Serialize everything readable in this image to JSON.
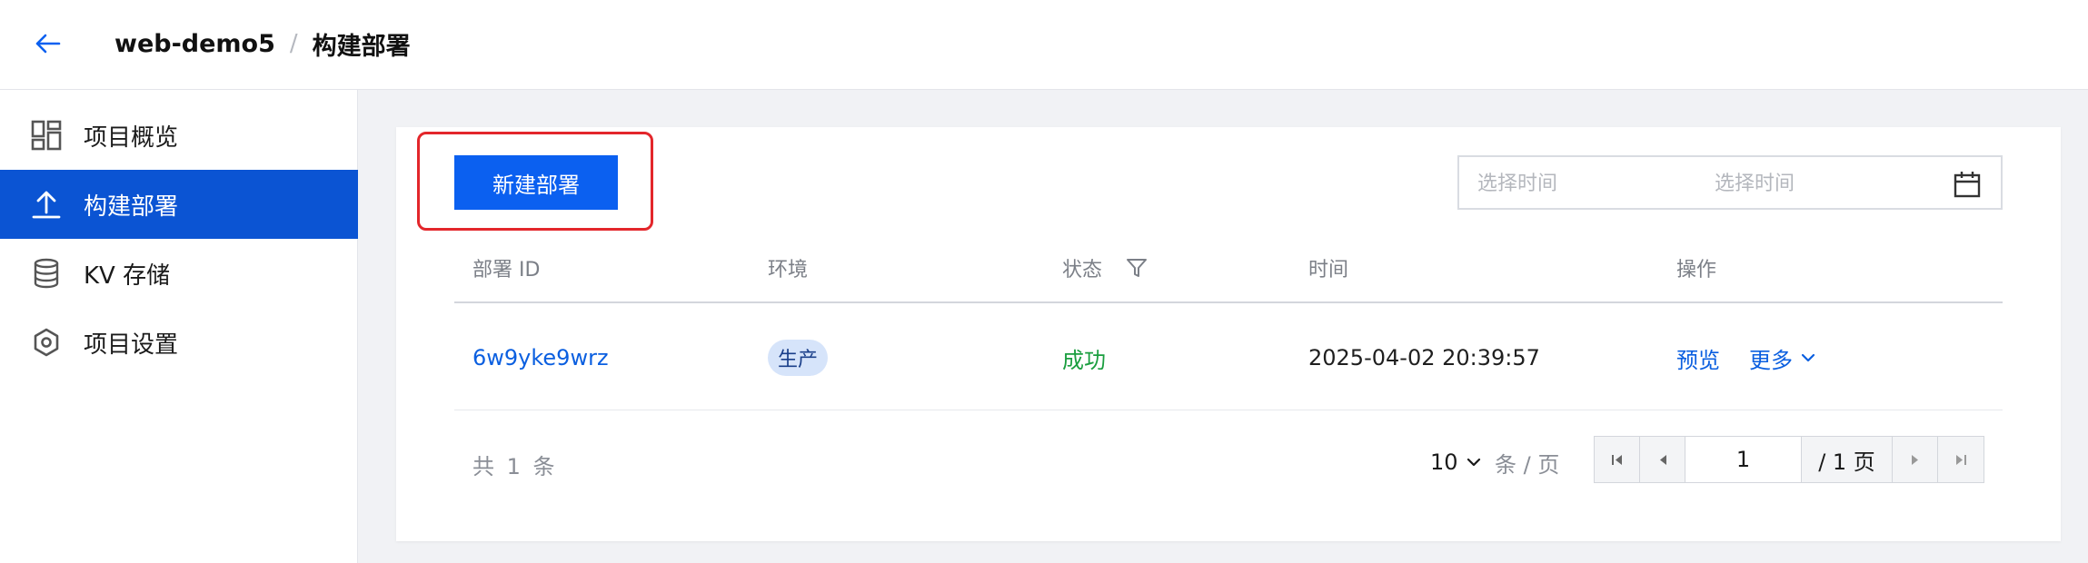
{
  "header": {
    "app_name": "web-demo5",
    "separator": "/",
    "page_title": "构建部署"
  },
  "sidebar": {
    "items": [
      {
        "label": "项目概览",
        "icon": "dashboard-icon",
        "active": false
      },
      {
        "label": "构建部署",
        "icon": "upload-icon",
        "active": true
      },
      {
        "label": "KV 存储",
        "icon": "database-icon",
        "active": false
      },
      {
        "label": "项目设置",
        "icon": "settings-icon",
        "active": false
      }
    ]
  },
  "toolbar": {
    "create_label": "新建部署",
    "date_start_placeholder": "选择时间",
    "date_end_placeholder": "选择时间"
  },
  "table": {
    "columns": [
      "部署 ID",
      "环境",
      "状态",
      "时间",
      "操作"
    ],
    "rows": [
      {
        "id": "6w9yke9wrz",
        "env": "生产",
        "status": "成功",
        "time": "2025-04-02 20:39:57",
        "actions": [
          "预览",
          "更多"
        ]
      }
    ]
  },
  "pagination": {
    "total_text": "共 1 条",
    "page_size": "10",
    "per_page_text": "条 / 页",
    "current_page": "1",
    "total_pages_text": "/ 1 页"
  },
  "colors": {
    "accent": "#0b60f0",
    "sidebar_active": "#0b54d3",
    "success": "#1a9e3f",
    "highlight": "#e3262b"
  }
}
